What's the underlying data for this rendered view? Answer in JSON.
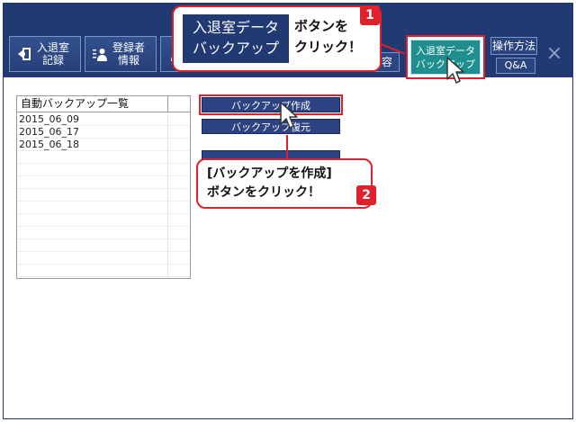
{
  "toolbar": {
    "inout_label": "入退室\n記録",
    "register_label": "登録者\n情報",
    "partial_label": "容",
    "backup_label": "入退室データ\nバックアップ",
    "manual_label": "操作方法",
    "qa_label": "Q&A",
    "close_glyph": "×"
  },
  "list": {
    "header": "自動バックアップ一覧",
    "rows": [
      "2015_06_09",
      "2015_06_17",
      "2015_06_18"
    ]
  },
  "actions": {
    "create": "バックアップ作成",
    "restore": "バックアップ復元",
    "third": ""
  },
  "callouts": {
    "c1_box": "入退室データ\nバックアップ",
    "c1_text": "ボタンを\nクリック！",
    "c1_badge": "1",
    "c2_text": "[バックアップを作成]\nボタンをクリック！",
    "c2_badge": "2"
  },
  "colors": {
    "navy": "#223a73",
    "teal": "#1f8e8e",
    "red": "#e0202a"
  }
}
